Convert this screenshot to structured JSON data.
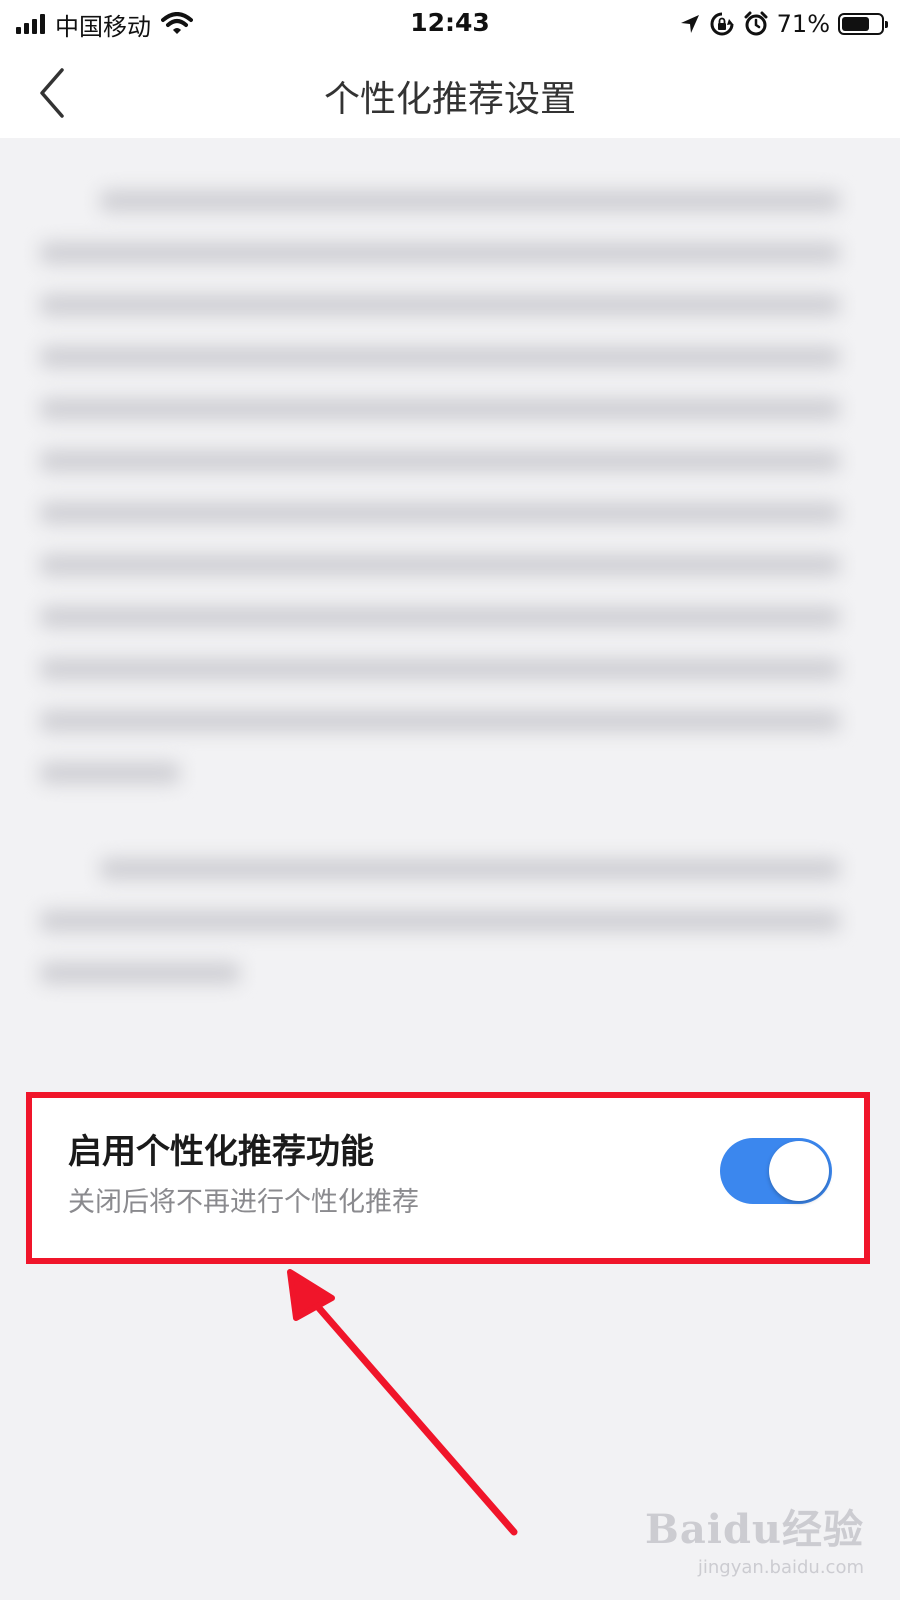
{
  "status_bar": {
    "carrier": "中国移动",
    "time": "12:43",
    "battery_percent": "71%",
    "battery_level": 0.71,
    "icons": [
      "signal-icon",
      "wifi-icon",
      "location-icon",
      "rotation-lock-icon",
      "alarm-icon",
      "battery-icon"
    ]
  },
  "nav": {
    "title": "个性化推荐设置",
    "back_icon": "chevron-left-icon"
  },
  "setting": {
    "title": "启用个性化推荐功能",
    "subtitle": "关闭后将不再进行个性化推荐",
    "enabled": true
  },
  "watermark": {
    "logo": "Baidu经验",
    "url": "jingyan.baidu.com"
  },
  "colors": {
    "toggle_on": "#3b87ee",
    "annotation_red": "#f0152a",
    "background": "#f2f2f4"
  }
}
